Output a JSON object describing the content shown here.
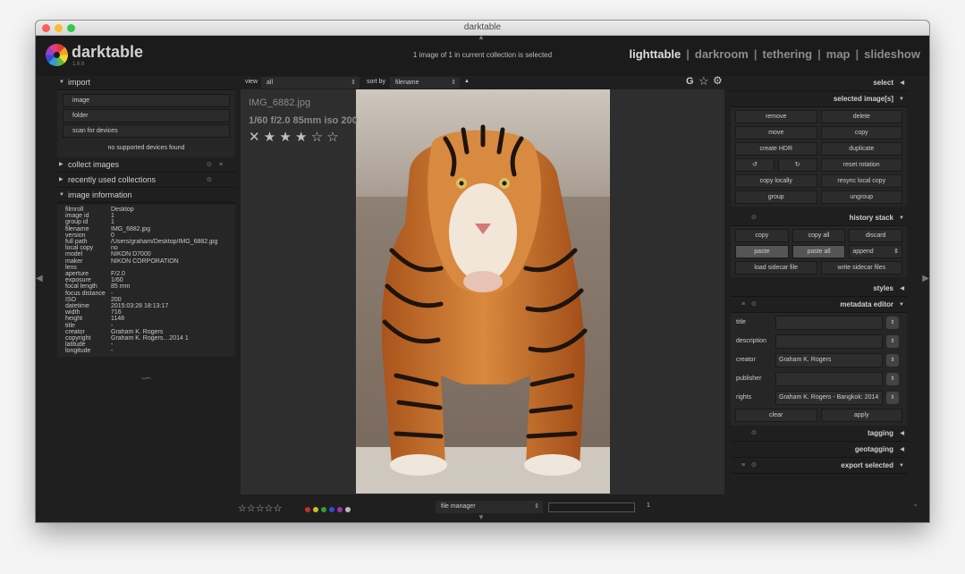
{
  "window": {
    "title": "darktable"
  },
  "app": {
    "name": "darktable",
    "version": "1.6.6"
  },
  "header": {
    "selection_status": "1 image of 1 in current collection is selected",
    "views": [
      "lighttable",
      "darkroom",
      "tethering",
      "map",
      "slideshow"
    ],
    "active_view": "lighttable"
  },
  "left": {
    "import": {
      "title": "import",
      "buttons": [
        "image",
        "folder",
        "scan for devices"
      ],
      "note": "no supported devices found"
    },
    "collect": {
      "title": "collect images"
    },
    "recent": {
      "title": "recently used collections"
    },
    "info": {
      "title": "image information",
      "rows": [
        [
          "filmroll",
          "Desktop"
        ],
        [
          "image id",
          "1"
        ],
        [
          "group id",
          "1"
        ],
        [
          "filename",
          "IMG_6882.jpg"
        ],
        [
          "version",
          "0"
        ],
        [
          "full path",
          "/Users/graham/Desktop/IMG_6882.jpg"
        ],
        [
          "local copy",
          "no"
        ],
        [
          "model",
          "NIKON D7000"
        ],
        [
          "maker",
          "NIKON CORPORATION"
        ],
        [
          "lens",
          ""
        ],
        [
          "aperture",
          "F/2.0"
        ],
        [
          "exposure",
          "1/60"
        ],
        [
          "focal length",
          "85 mm"
        ],
        [
          "focus distance",
          "-"
        ],
        [
          "ISO",
          "200"
        ],
        [
          "datetime",
          "2015:03:28 18:13:17"
        ],
        [
          "width",
          "716"
        ],
        [
          "height",
          "1148"
        ],
        [
          "title",
          "-"
        ],
        [
          "creator",
          "Graham K. Rogers"
        ],
        [
          "copyright",
          "Graham K. Rogers…2014 1"
        ],
        [
          "latitude",
          "-"
        ],
        [
          "longitude",
          "-"
        ]
      ]
    }
  },
  "center": {
    "view_label": "view",
    "view_value": "all",
    "sort_label": "sort by",
    "sort_value": "filename",
    "sort_dir": "▲",
    "filename": "IMG_6882.jpg",
    "exif": "1/60 f/2.0 85mm iso 200",
    "stars": "✕ ★ ★ ★ ☆ ☆",
    "bottom_stars": "☆☆☆☆☆",
    "mode": "file manager",
    "count": "1",
    "color_labels": [
      "#c03030",
      "#c8c020",
      "#30a030",
      "#3050c8",
      "#a030b0",
      "#bbbbbb"
    ]
  },
  "right": {
    "select": "select",
    "selected": "selected image[s]",
    "sel_buttons": [
      "remove",
      "delete",
      "move",
      "copy",
      "create HDR",
      "duplicate",
      "↺",
      "↻",
      "reset rotation",
      "copy locally",
      "resync local copy",
      "group",
      "ungroup"
    ],
    "history": {
      "title": "history stack",
      "buttons": [
        "copy",
        "copy all",
        "discard",
        "paste",
        "paste all",
        "append",
        "load sidecar file",
        "write sidecar files"
      ]
    },
    "styles": "styles",
    "metadata": {
      "title": "metadata editor",
      "fields": [
        [
          "title",
          ""
        ],
        [
          "description",
          ""
        ],
        [
          "creator",
          "Graham K. Rogers"
        ],
        [
          "publisher",
          ""
        ],
        [
          "rights",
          "Graham K. Rogers  - Bangkok: 2014"
        ]
      ],
      "clear": "clear",
      "apply": "apply"
    },
    "tagging": "tagging",
    "geotagging": "geotagging",
    "export": "export selected"
  },
  "toolbar_icons": {
    "grouping": "G",
    "star": "☆",
    "gear": "⚙"
  }
}
